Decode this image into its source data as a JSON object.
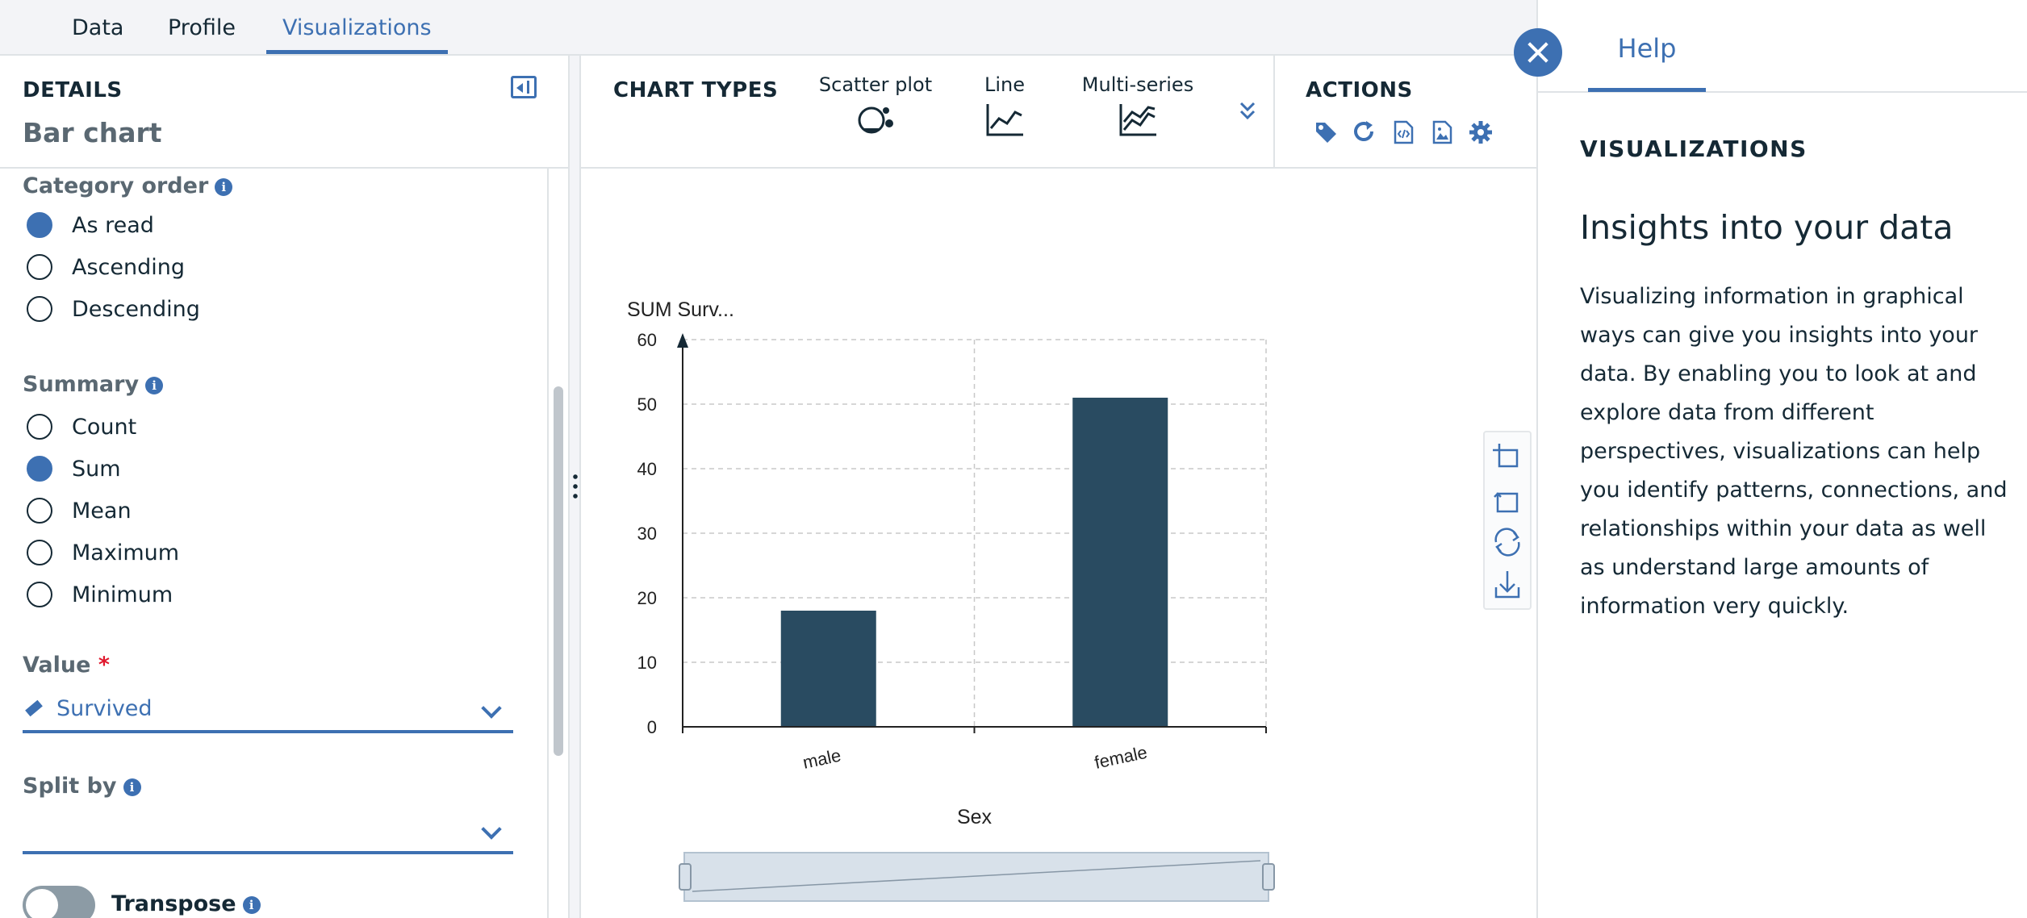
{
  "top_tabs": [
    {
      "label": "Data"
    },
    {
      "label": "Profile"
    },
    {
      "label": "Visualizations",
      "active": true
    }
  ],
  "details": {
    "heading": "DETAILS",
    "chart_name": "Bar chart"
  },
  "category_order": {
    "label": "Category order",
    "options": [
      "As read",
      "Ascending",
      "Descending"
    ],
    "selected": "As read"
  },
  "summary": {
    "label": "Summary",
    "options": [
      "Count",
      "Sum",
      "Mean",
      "Maximum",
      "Minimum"
    ],
    "selected": "Sum"
  },
  "value_field": {
    "label": "Value",
    "required_mark": "*",
    "selected": "Survived"
  },
  "split_by": {
    "label": "Split by",
    "selected": ""
  },
  "transpose": {
    "label": "Transpose",
    "on": false
  },
  "chart_types": {
    "heading": "CHART TYPES",
    "items": [
      "Scatter plot",
      "Line",
      "Multi-series"
    ]
  },
  "actions": {
    "heading": "ACTIONS",
    "icons": [
      "tag-icon",
      "refresh-icon",
      "code-icon",
      "image-icon",
      "gear-icon"
    ]
  },
  "help": {
    "tab": "Help",
    "heading": "VISUALIZATIONS",
    "title": "Insights into your data",
    "body": "Visualizing information in graphical ways can give you insights into your data. By enabling you to look at and explore data from different perspectives, visualizations can help you identify patterns, connections, and relationships within your data as well as understand large amounts of information very quickly."
  },
  "colors": {
    "accent": "#3d70b2",
    "bar": "#294b61",
    "text": "#152935"
  },
  "chart_data": {
    "type": "bar",
    "categories": [
      "male",
      "female"
    ],
    "values": [
      18,
      51
    ],
    "title": "SUM Surv...",
    "xlabel": "Sex",
    "ylabel": "",
    "ylim": [
      0,
      60
    ],
    "yticks": [
      0,
      10,
      20,
      30,
      40,
      50,
      60
    ],
    "grid": true
  }
}
